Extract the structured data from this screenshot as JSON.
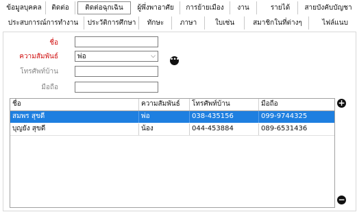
{
  "tabs_row1": [
    {
      "label": "ข้อมูลบุคคล"
    },
    {
      "label": "ติดต่อ"
    },
    {
      "label": "ติดต่อฉุกเฉิน"
    },
    {
      "label": "ผู้พึ่งพาอาศัย"
    },
    {
      "label": "การย้ายเมือง"
    },
    {
      "label": "งาน"
    },
    {
      "label": "รายได้"
    },
    {
      "label": "สายบังคับบัญชา"
    }
  ],
  "tabs_row2": [
    {
      "label": "ประสบการณ์การทำงาน"
    },
    {
      "label": "ประวัติการศึกษา"
    },
    {
      "label": "ทักษะ"
    },
    {
      "label": "ภาษา"
    },
    {
      "label": "ใบเซ่น"
    },
    {
      "label": "สมาชิกในที่ต่างๆ"
    },
    {
      "label": "ไฟล์แนบ"
    }
  ],
  "active_tab": "ติดต่อฉุกเฉิน",
  "form": {
    "name_label": "ชื่อ",
    "name_value": "",
    "relation_label": "ความสัมพันธ์",
    "relation_value": "พ่อ",
    "more_glyph": "•••",
    "home_phone_label": "โทรศัพท์บ้าน",
    "home_phone_value": "",
    "mobile_label": "มือถือ",
    "mobile_value": ""
  },
  "table": {
    "headers": [
      "ชื่อ",
      "ความสัมพันธ์",
      "โทรศัพท์บ้าน",
      "มือถือ"
    ],
    "rows": [
      [
        "สมพร สุขดี",
        "พ่อ",
        "038-435156",
        "099-9744325"
      ],
      [
        "บุญยัง สุขดี",
        "น้อง",
        "044-453884",
        "089-6531436"
      ]
    ],
    "add_glyph": "+",
    "remove_glyph": "−"
  }
}
